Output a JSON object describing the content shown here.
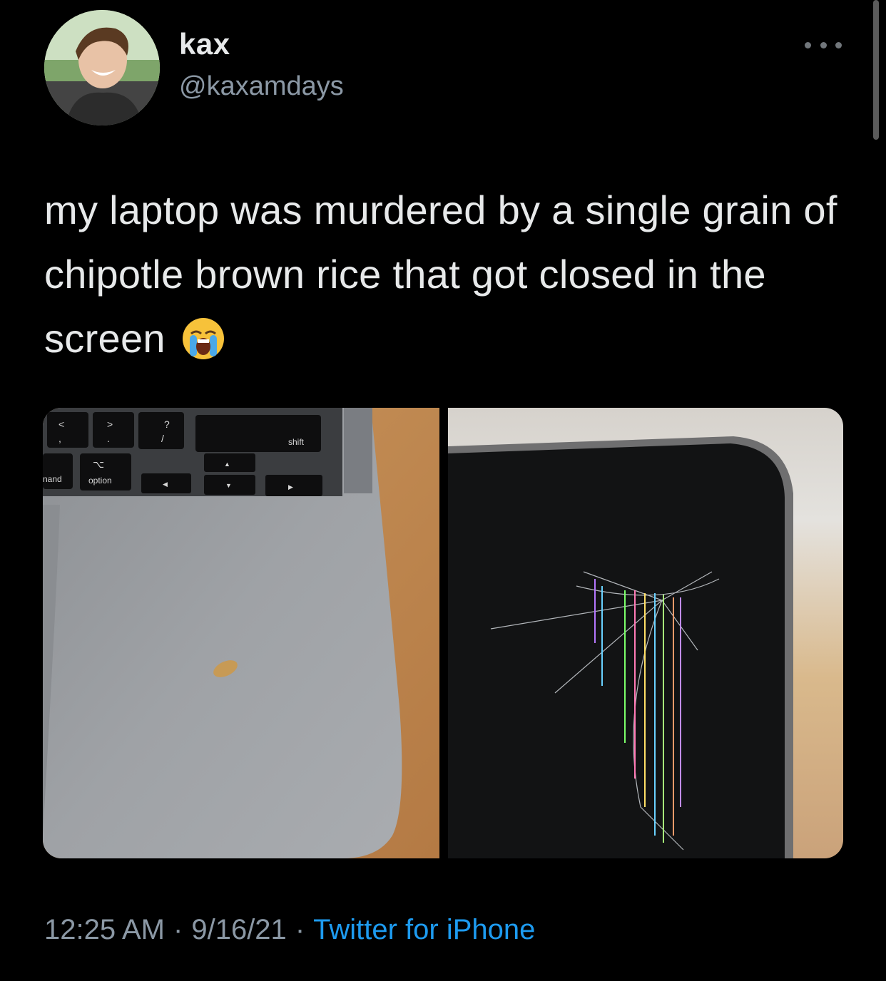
{
  "author": {
    "display_name": "kax",
    "handle": "@kaxamdays"
  },
  "more_icon": "more-horizontal-icon",
  "tweet": {
    "text": "my laptop was murdered by a single grain of chipotle brown rice that got closed in the screen",
    "emoji": "loudly-crying-face"
  },
  "media": {
    "photo_1": {
      "subject": "laptop keyboard deck with a grain of rice",
      "key_labels": {
        "less_than": "<",
        "comma": ",",
        "greater_than": ">",
        "period": ".",
        "question": "?",
        "slash": "/",
        "shift": "shift",
        "option_glyph": "⌥",
        "option": "option",
        "command_partial": "nand",
        "arrow_up": "▲",
        "arrow_left": "◀",
        "arrow_down": "▼",
        "arrow_right": "▶"
      }
    },
    "photo_2": {
      "subject": "cracked laptop screen"
    }
  },
  "footer": {
    "time": "12:25 AM",
    "separator": "·",
    "date": "9/16/21",
    "source": "Twitter for iPhone"
  },
  "colors": {
    "background": "#000000",
    "text": "#e7e9ea",
    "secondary": "#8b98a5",
    "link": "#1d9bf0"
  }
}
